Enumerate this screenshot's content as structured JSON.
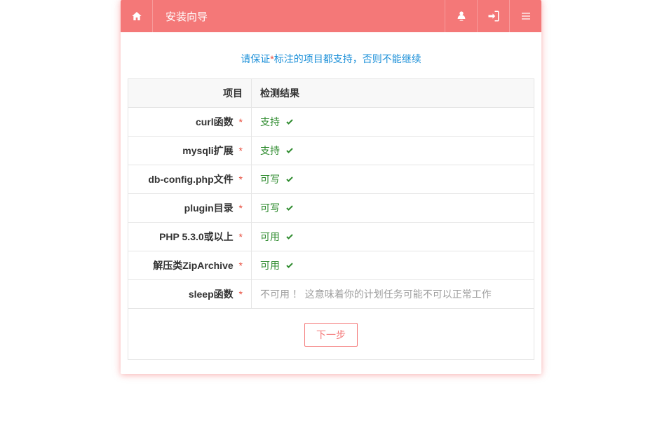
{
  "header": {
    "title": "安装向导"
  },
  "notice": {
    "part1": "请保证",
    "star": "*",
    "part2": "标注的项目都支持，否则不能继续"
  },
  "table": {
    "header_left": "项目",
    "header_right": "检测结果",
    "rows": [
      {
        "label": "curl函数",
        "required": true,
        "status_text": "支持",
        "status_ok": true
      },
      {
        "label": "mysqli扩展",
        "required": true,
        "status_text": "支持",
        "status_ok": true
      },
      {
        "label": "db-config.php文件",
        "required": true,
        "status_text": "可写",
        "status_ok": true
      },
      {
        "label": "plugin目录",
        "required": true,
        "status_text": "可写",
        "status_ok": true
      },
      {
        "label": "PHP 5.3.0或以上",
        "required": true,
        "status_text": "可用",
        "status_ok": true
      },
      {
        "label": "解压类ZipArchive",
        "required": true,
        "status_text": "可用",
        "status_ok": true
      },
      {
        "label": "sleep函数",
        "required": true,
        "status_text": "不可用 ！ 这意味着你的计划任务可能不可以正常工作",
        "status_ok": false
      }
    ]
  },
  "footer": {
    "next_label": "下一步"
  }
}
